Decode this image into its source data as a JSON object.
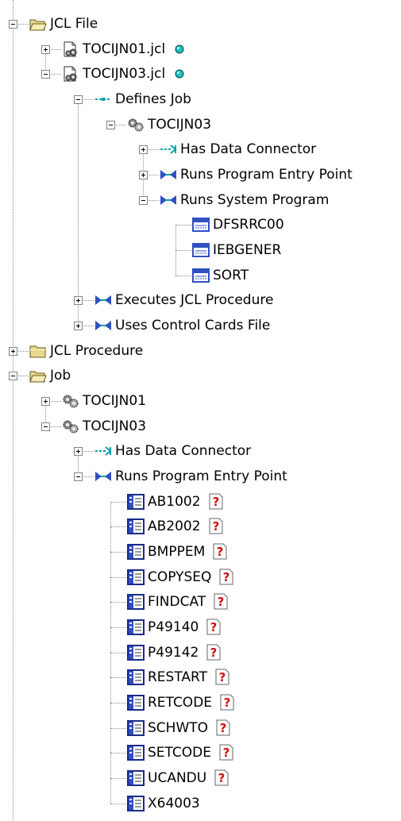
{
  "colors": {
    "folder": "#e8d88a",
    "connector": "#00a0b0",
    "rel_icon": "#3050c0",
    "status_dot": "#20c0c0",
    "unknown_mark": "#d01010"
  },
  "tree": {
    "nodes": [
      {
        "label": "JCL File",
        "icon": "folder-open-icon",
        "level": 0,
        "exp": "minus"
      },
      {
        "label": "TOCIJN01.jcl",
        "icon": "jcl-file-icon",
        "level": 1,
        "exp": "plus",
        "badge": "status-dot"
      },
      {
        "label": "TOCIJN03.jcl",
        "icon": "jcl-file-icon",
        "level": 1,
        "exp": "minus",
        "badge": "status-dot"
      },
      {
        "label": "Defines Job",
        "icon": "defines-relationship-icon",
        "level": 2,
        "exp": "minus"
      },
      {
        "label": "TOCIJN03",
        "icon": "job-gears-icon",
        "level": 3,
        "exp": "minus"
      },
      {
        "label": "Has Data Connector",
        "icon": "data-connector-relationship-icon",
        "level": 4,
        "exp": "plus"
      },
      {
        "label": "Runs Program Entry Point",
        "icon": "runs-relationship-icon",
        "level": 4,
        "exp": "plus"
      },
      {
        "label": "Runs System Program",
        "icon": "runs-relationship-icon",
        "level": 4,
        "exp": "minus"
      },
      {
        "label": "DFSRRC00",
        "icon": "system-program-icon",
        "level": 5
      },
      {
        "label": "IEBGENER",
        "icon": "system-program-icon",
        "level": 5
      },
      {
        "label": "SORT",
        "icon": "system-program-icon",
        "level": 5
      },
      {
        "label": "Executes JCL Procedure",
        "icon": "executes-relationship-icon",
        "level": 2,
        "exp": "plus"
      },
      {
        "label": "Uses Control Cards File",
        "icon": "uses-relationship-icon",
        "level": 2,
        "exp": "plus"
      },
      {
        "label": "JCL Procedure",
        "icon": "folder-closed-icon",
        "level": 0,
        "exp": "plus"
      },
      {
        "label": "Job",
        "icon": "folder-open-icon",
        "level": 0,
        "exp": "minus"
      },
      {
        "label": "TOCIJN01",
        "icon": "job-gears-icon",
        "level": 1,
        "exp": "plus"
      },
      {
        "label": "TOCIJN03",
        "icon": "job-gears-icon",
        "level": 1,
        "exp": "minus"
      },
      {
        "label": "Has Data Connector",
        "icon": "data-connector-relationship-icon",
        "level": 2,
        "exp": "plus"
      },
      {
        "label": "Runs Program Entry Point",
        "icon": "runs-relationship-icon",
        "level": 2,
        "exp": "minus"
      },
      {
        "label": "AB1002",
        "icon": "program-entry-icon",
        "level": 3,
        "badge": "unknown"
      },
      {
        "label": "AB2002",
        "icon": "program-entry-icon",
        "level": 3,
        "badge": "unknown"
      },
      {
        "label": "BMPPEM",
        "icon": "program-entry-icon",
        "level": 3,
        "badge": "unknown"
      },
      {
        "label": "COPYSEQ",
        "icon": "program-entry-icon",
        "level": 3,
        "badge": "unknown"
      },
      {
        "label": "FINDCAT",
        "icon": "program-entry-icon",
        "level": 3,
        "badge": "unknown"
      },
      {
        "label": "P49140",
        "icon": "program-entry-icon",
        "level": 3,
        "badge": "unknown"
      },
      {
        "label": "P49142",
        "icon": "program-entry-icon",
        "level": 3,
        "badge": "unknown"
      },
      {
        "label": "RESTART",
        "icon": "program-entry-icon",
        "level": 3,
        "badge": "unknown"
      },
      {
        "label": "RETCODE",
        "icon": "program-entry-icon",
        "level": 3,
        "badge": "unknown"
      },
      {
        "label": "SCHWTO",
        "icon": "program-entry-icon",
        "level": 3,
        "badge": "unknown"
      },
      {
        "label": "SETCODE",
        "icon": "program-entry-icon",
        "level": 3,
        "badge": "unknown"
      },
      {
        "label": "UCANDU",
        "icon": "program-entry-icon",
        "level": 3,
        "badge": "unknown"
      },
      {
        "label": "X64003",
        "icon": "program-entry-icon",
        "level": 3
      }
    ]
  }
}
